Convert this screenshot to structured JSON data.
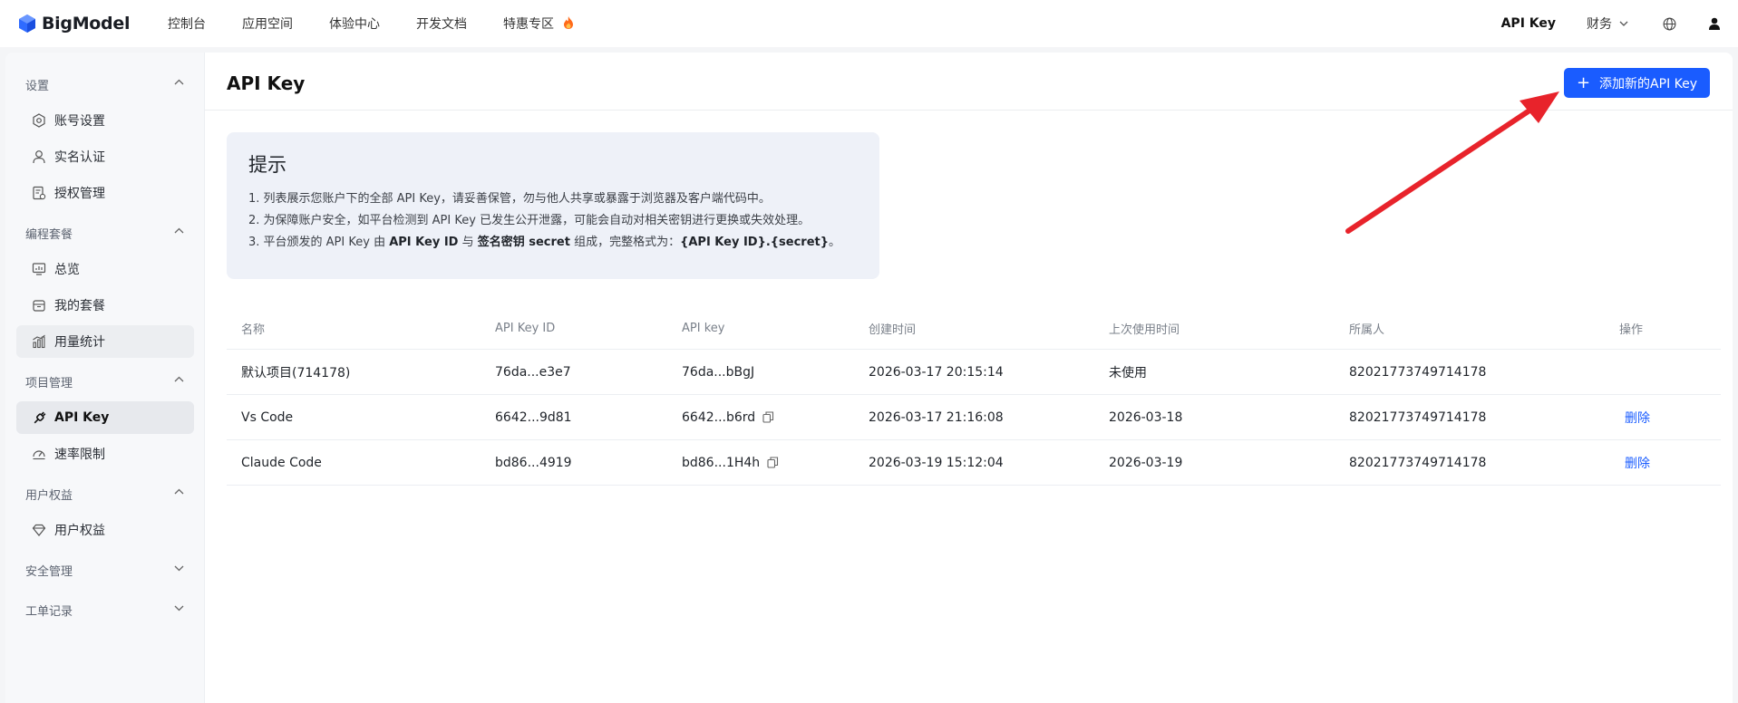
{
  "brand": {
    "name": "BigModel"
  },
  "nav": {
    "links": [
      "控制台",
      "应用空间",
      "体验中心",
      "开发文档",
      "特惠专区"
    ],
    "right": {
      "api_key": "API Key",
      "finance": "财务"
    }
  },
  "sidebar": {
    "sections": [
      {
        "title": "设置",
        "expanded": true,
        "items": [
          "账号设置",
          "实名认证",
          "授权管理"
        ]
      },
      {
        "title": "编程套餐",
        "expanded": true,
        "items": [
          "总览",
          "我的套餐",
          "用量统计"
        ]
      },
      {
        "title": "项目管理",
        "expanded": true,
        "items": [
          "API Key",
          "速率限制"
        ]
      },
      {
        "title": "用户权益",
        "expanded": true,
        "items": [
          "用户权益"
        ]
      },
      {
        "title": "安全管理",
        "expanded": false,
        "items": []
      },
      {
        "title": "工单记录",
        "expanded": false,
        "items": []
      }
    ],
    "active_item": "API Key"
  },
  "page": {
    "title": "API Key",
    "add_button": "添加新的API Key"
  },
  "tip": {
    "title": "提示",
    "line1": "1. 列表展示您账户下的全部 API Key，请妥善保管，勿与他人共享或暴露于浏览器及客户端代码中。",
    "line2": "2. 为保障账户安全，如平台检测到 API Key 已发生公开泄露，可能会自动对相关密钥进行更换或失效处理。",
    "line3_a": "3. 平台颁发的 API Key 由 ",
    "line3_b": "API Key ID",
    "line3_c": " 与 ",
    "line3_d": "签名密钥 secret",
    "line3_e": " 组成，完整格式为：",
    "line3_f": "{API Key ID}.{secret}",
    "line3_g": "。"
  },
  "table": {
    "headers": [
      "名称",
      "API Key ID",
      "API key",
      "创建时间",
      "上次使用时间",
      "所属人",
      "操作"
    ],
    "rows": [
      {
        "name": "默认项目(714178)",
        "key_id": "76da...e3e7",
        "api_key": "76da...bBgJ",
        "created": "2026-03-17 20:15:14",
        "last_used": "未使用",
        "owner": "82021773749714178",
        "action": ""
      },
      {
        "name": "Vs Code",
        "key_id": "6642...9d81",
        "api_key": "6642...b6rd",
        "created": "2026-03-17 21:16:08",
        "last_used": "2026-03-18",
        "owner": "82021773749714178",
        "action": "删除"
      },
      {
        "name": "Claude Code",
        "key_id": "bd86...4919",
        "api_key": "bd86...1H4h",
        "created": "2026-03-19 15:12:04",
        "last_used": "2026-03-19",
        "owner": "82021773749714178",
        "action": "删除"
      }
    ]
  },
  "colors": {
    "accent": "#1a5cff",
    "annotation_arrow": "#e8232b"
  }
}
